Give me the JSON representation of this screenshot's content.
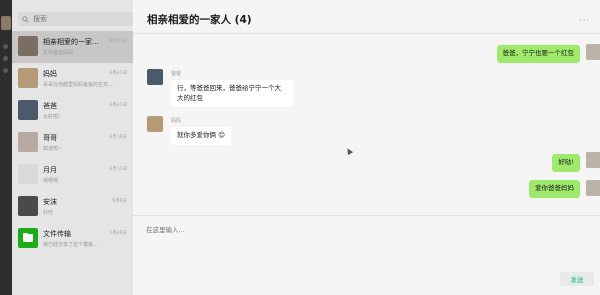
{
  "sidebar": {
    "search_placeholder": "搜索",
    "conversations": [
      {
        "name": "相亲相爱的一家...",
        "time": "6月21日",
        "preview": "爱你爸爸妈妈",
        "active": true,
        "avatar_color": "#7a6e60"
      },
      {
        "name": "妈妈",
        "time": "6月21日",
        "preview": "哥哥在他都里妈妈爸爸的生日...",
        "active": false,
        "avatar_color": "#b59a76"
      },
      {
        "name": "爸爸",
        "time": "6月21日",
        "preview": "太好啦!",
        "active": false,
        "avatar_color": "#4a5a6a"
      },
      {
        "name": "哥哥",
        "time": "6月19日",
        "preview": "知道啦~",
        "active": false,
        "avatar_color": "#b8aaa0"
      },
      {
        "name": "月月",
        "time": "6月11日",
        "preview": "嘻嘻嘻",
        "active": false,
        "avatar_color": "#d9d9d9"
      },
      {
        "name": "安沫",
        "time": "6月9日",
        "preview": "好哇",
        "active": false,
        "avatar_color": "#4a4a4a"
      },
      {
        "name": "文件传输",
        "time": "5月29日",
        "preview": "我已经分享了这个模板...",
        "active": false,
        "avatar_color": "#1aad19"
      }
    ]
  },
  "chat": {
    "title": "相亲相爱的一家人 (4)",
    "more_icon": "more-dots-icon",
    "messages": [
      {
        "side": "right",
        "sender": "",
        "text": "爸爸，宁宁也要一个红包"
      },
      {
        "side": "left",
        "sender": "爸爸",
        "text": "行，等爸爸回来，爸爸给宁宁一个大大的红包"
      },
      {
        "side": "left",
        "sender": "妈妈",
        "text": "就你多爱你俩 😊"
      },
      {
        "side": "right",
        "sender": "",
        "text": "好哒!"
      },
      {
        "side": "right",
        "sender": "",
        "text": "爱你爸爸妈妈"
      }
    ],
    "input_placeholder": "在这里输入...",
    "send_label": "发送"
  },
  "colors": {
    "bubble_self": "#9eea6a",
    "bubble_other": "#ffffff",
    "sidebar_bg": "#e6e5e5",
    "active_conv": "#c9c7c6",
    "strip_bg": "#2e2e2e",
    "send_text": "#07c160"
  }
}
